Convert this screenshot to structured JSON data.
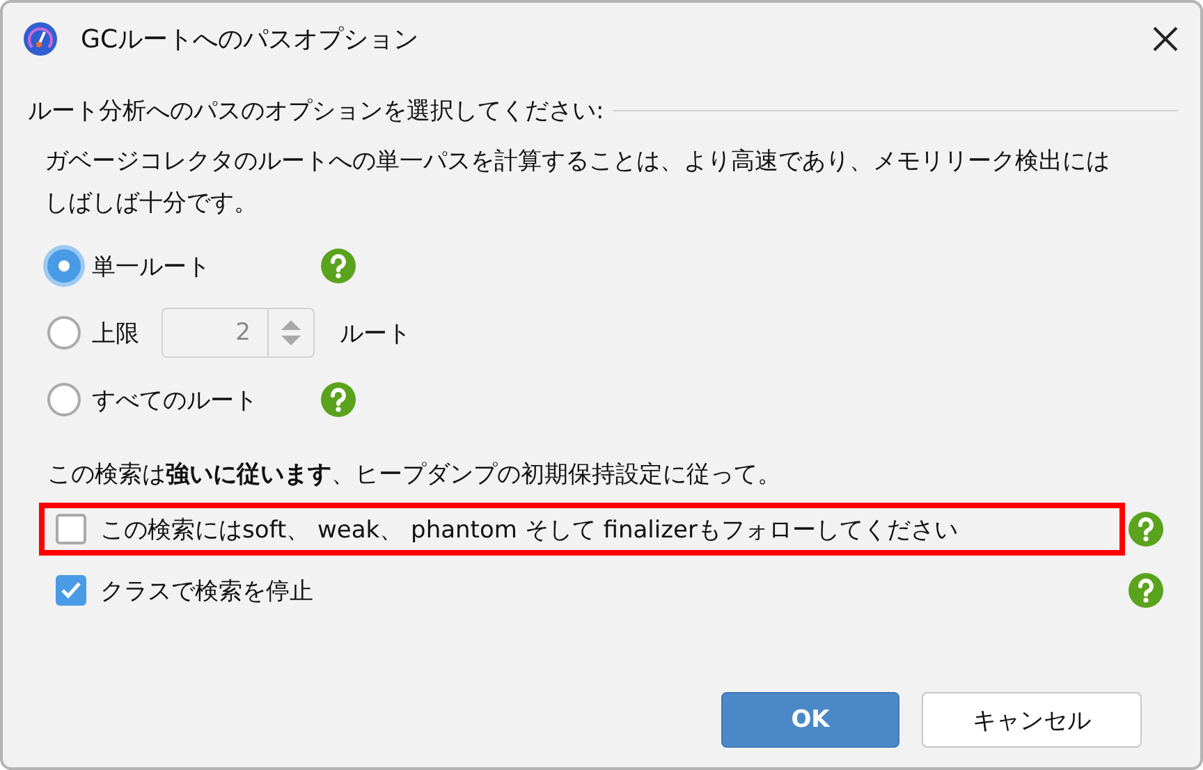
{
  "window": {
    "title": "GCルートへのパスオプション"
  },
  "section": {
    "heading": "ルート分析へのパスのオプションを選択してください:"
  },
  "description": "ガベージコレクタのルートへの単一パスを計算することは、より高速であり、メモリリーク検出にはしばしば十分です。",
  "radios": [
    {
      "kind": "help",
      "label": "単一ルート",
      "selected": true
    },
    {
      "kind": "limit",
      "label": "上限",
      "spinner": {
        "value": "2",
        "disabled": true
      },
      "suffix": "ルート",
      "selected": false
    },
    {
      "kind": "help",
      "label": "すべてのルート",
      "selected": false
    }
  ],
  "note": "この検索は**強いに従います**、ヒープダンプの初期保持設定に従って。",
  "options": [
    {
      "label": "この検索にはsoft、 weak、 phantom そして finalizerもフォローしてください",
      "checked": false,
      "highlighted": true
    },
    {
      "label": "クラスで検索を停止",
      "checked": true,
      "highlighted": false
    }
  ],
  "buttons": [
    {
      "label": "OK",
      "kind": "primary"
    },
    {
      "label": "キャンセル",
      "kind": "secondary"
    }
  ]
}
